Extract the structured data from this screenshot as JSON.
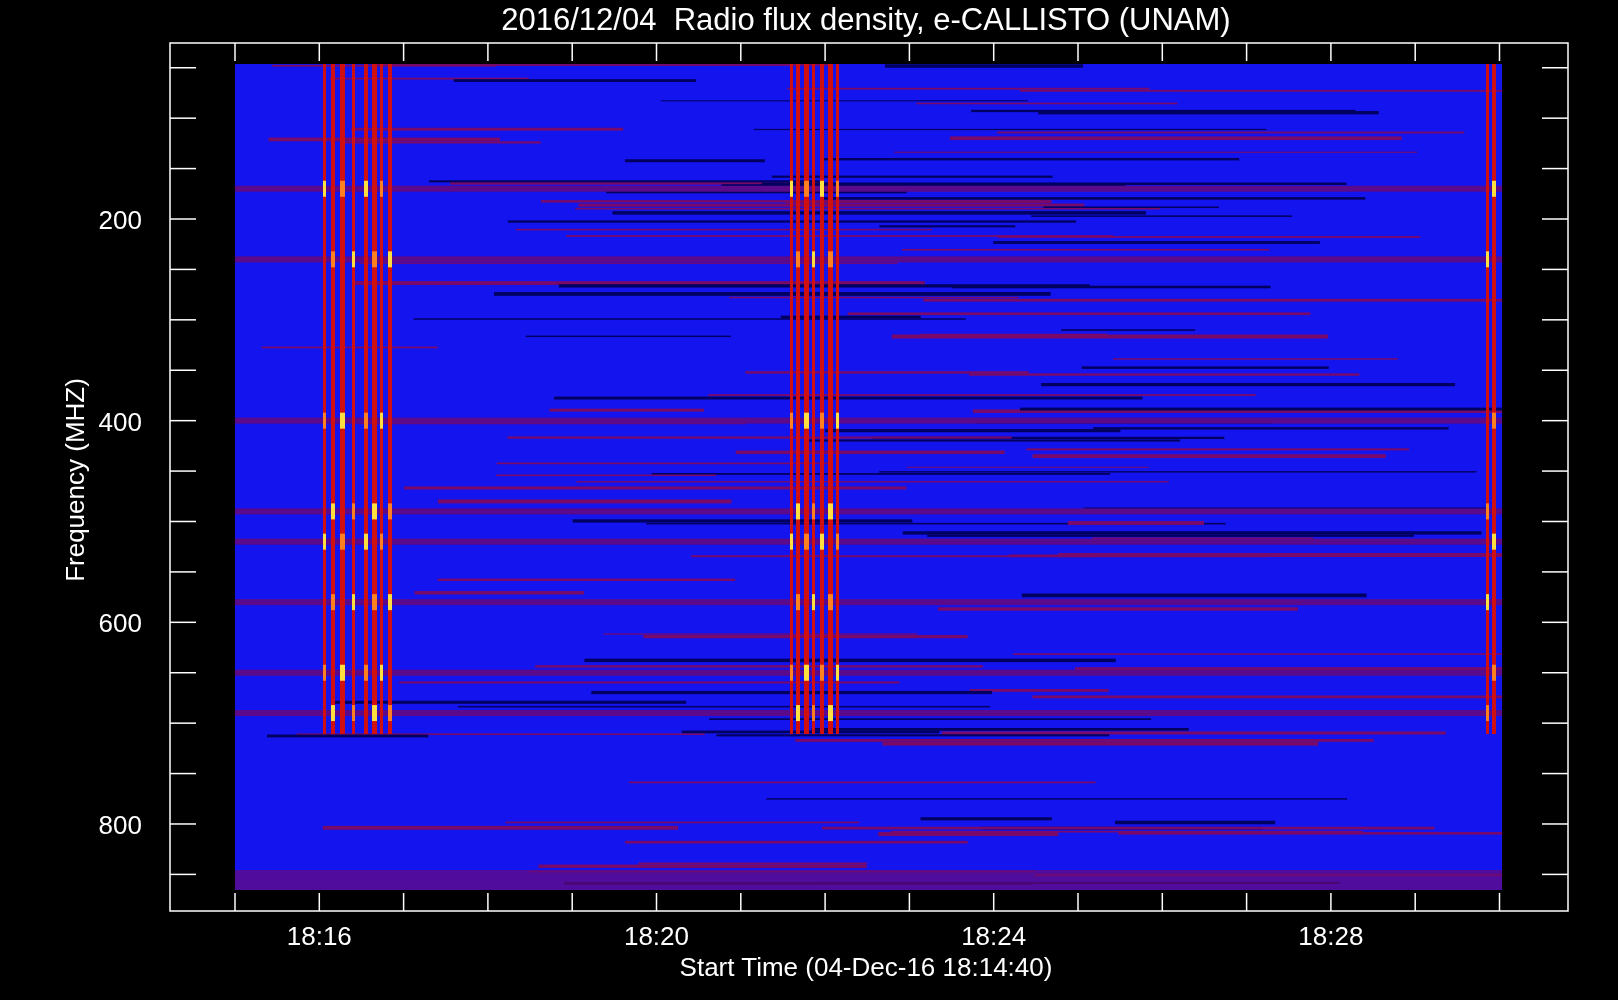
{
  "plot": {
    "title": "2016/12/04  Radio flux density, e-CALLISTO (UNAM)",
    "ylabel": "Frequency (MHZ)",
    "xlabel": "Start Time (04-Dec-16 18:14:40)",
    "yticks": [
      {
        "label": "200"
      },
      {
        "label": "400"
      },
      {
        "label": "600"
      },
      {
        "label": "800"
      }
    ],
    "xticks": [
      {
        "label": "18:16"
      },
      {
        "label": "18:20"
      },
      {
        "label": "18:24"
      },
      {
        "label": "18:28"
      }
    ]
  }
}
